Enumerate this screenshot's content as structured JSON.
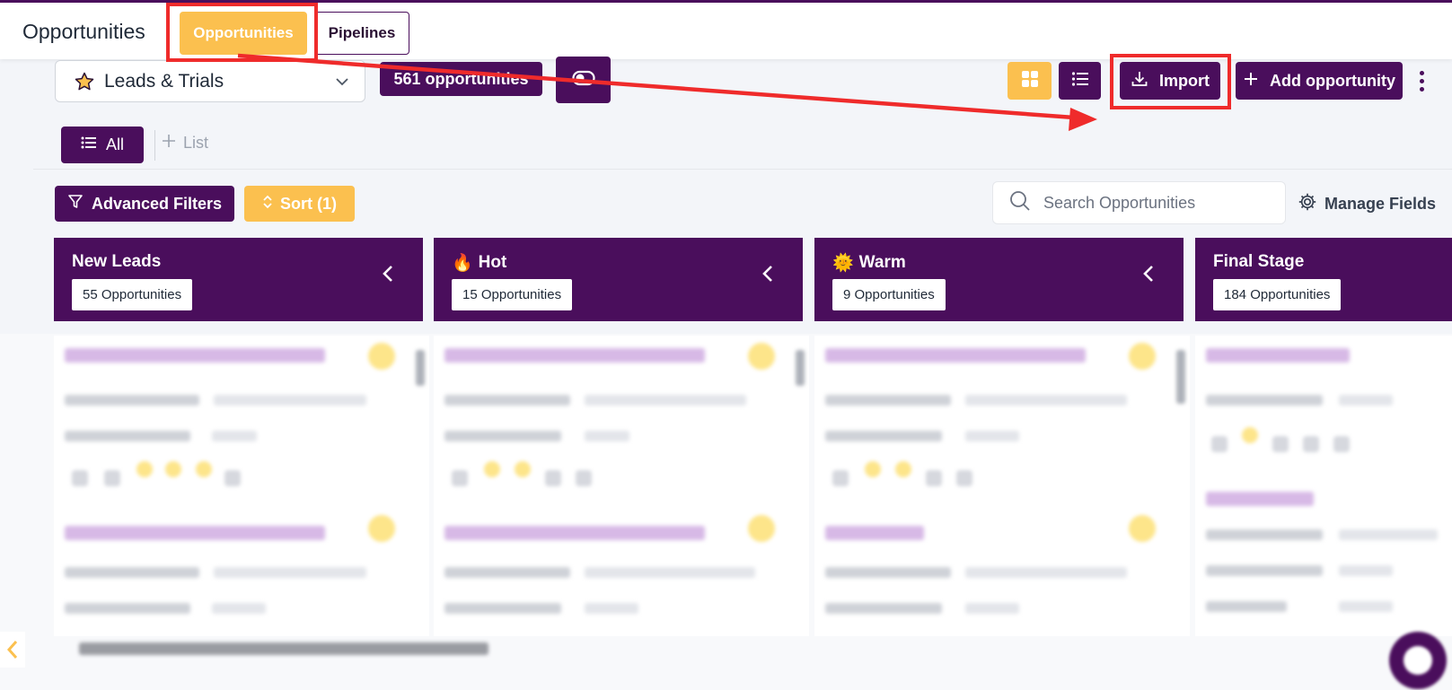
{
  "header": {
    "title": "Opportunities",
    "tabs": [
      {
        "label": "Opportunities",
        "active": true
      },
      {
        "label": "Pipelines",
        "active": false
      }
    ]
  },
  "toolbar": {
    "pipeline_select": "Leads & Trials",
    "opportunity_count": "561 opportunities",
    "import_label": "Import",
    "add_label": "Add opportunity"
  },
  "views": {
    "all_label": "All",
    "add_list_label": "List"
  },
  "filters": {
    "advanced_label": "Advanced Filters",
    "sort_label": "Sort (1)",
    "search_placeholder": "Search Opportunities",
    "manage_fields_label": "Manage Fields"
  },
  "stages": [
    {
      "title": "New Leads",
      "emoji": "",
      "count": "55 Opportunities"
    },
    {
      "title": "Hot",
      "emoji": "🔥",
      "count": "15 Opportunities"
    },
    {
      "title": "Warm",
      "emoji": "🌞",
      "count": "9 Opportunities"
    },
    {
      "title": "Final Stage",
      "emoji": "",
      "count": "184 Opportunities"
    }
  ],
  "colors": {
    "brand_purple": "#4a0e5c",
    "accent_yellow": "#fbc04f",
    "annotation_red": "#ef2b2b"
  },
  "icons": [
    "star-icon",
    "chevron-down-icon",
    "toggle-icon",
    "grid-icon",
    "list-icon",
    "download-icon",
    "plus-icon",
    "kebab-icon",
    "filter-icon",
    "sort-icon",
    "search-icon",
    "gear-icon",
    "chevron-left-icon",
    "chat-icon"
  ]
}
